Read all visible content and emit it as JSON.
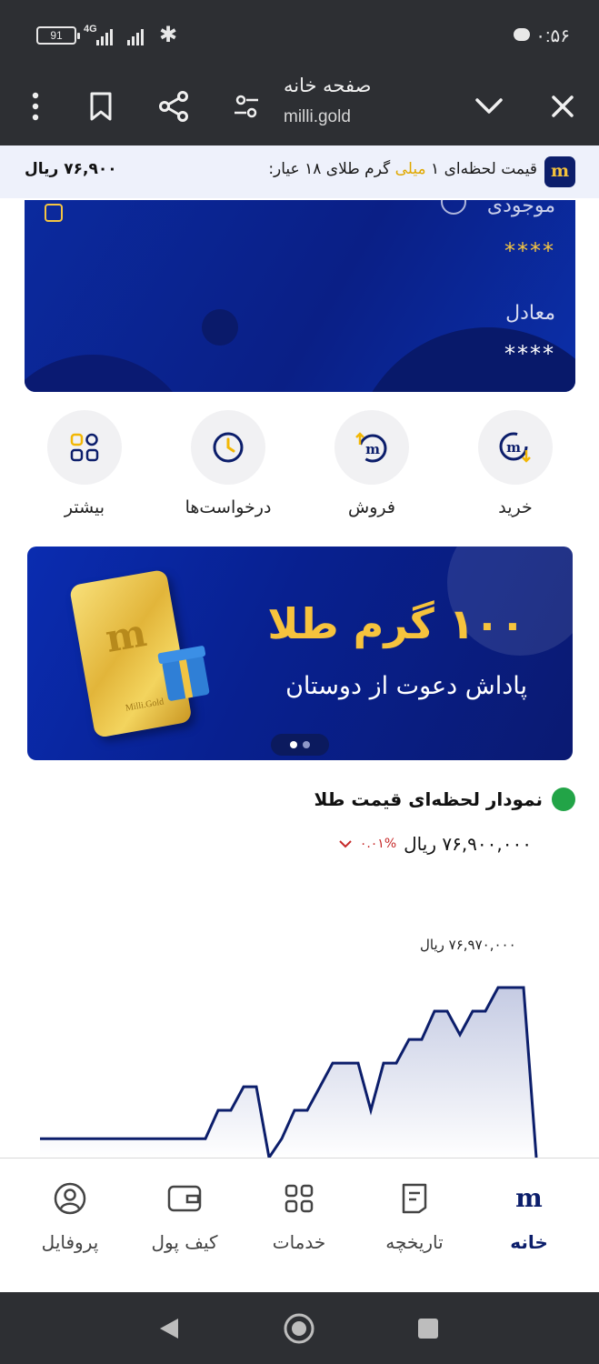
{
  "status_bar": {
    "battery": "91",
    "network": "4G",
    "time": "۰:۵۶"
  },
  "browser": {
    "title": "صفحه خانه",
    "url": "milli.gold"
  },
  "ticker": {
    "text_before": "قیمت لحظه‌ای ۱ ",
    "highlight": "میلی",
    "text_after": " گرم طلای ۱۸ عیار:",
    "price": "۷۶,۹۰۰ ریال",
    "logo_letter": "m"
  },
  "wallet": {
    "balance_label": "موجودی",
    "balance_value": "****",
    "equivalent_label": "معادل",
    "equivalent_value": "****"
  },
  "actions": [
    {
      "label": "خرید",
      "icon": "buy-icon"
    },
    {
      "label": "فروش",
      "icon": "sell-icon"
    },
    {
      "label": "درخواست‌ها",
      "icon": "clock-icon"
    },
    {
      "label": "بیشتر",
      "icon": "grid-icon"
    }
  ],
  "banner": {
    "headline": "۱۰۰ گرم طلا",
    "subline": "پاداش دعوت از دوستان",
    "gold_bar_letter": "m",
    "gold_bar_mark": "Milli.Gold",
    "slide_count": 2,
    "active_slide": 1
  },
  "chart": {
    "title": "نمودار لحظه‌ای قیمت طلا",
    "current_price": "۷۶,۹۰۰,۰۰۰ ریال",
    "change": "۰.۰۱%",
    "peak_label": "۷۶,۹۷۰,۰۰۰ ریال"
  },
  "chart_data": {
    "type": "area",
    "title": "نمودار لحظه‌ای قیمت طلا",
    "xlabel": "",
    "ylabel": "",
    "x": [
      0,
      1,
      2,
      3,
      4,
      5,
      6,
      7,
      8,
      9,
      10,
      11,
      12,
      13,
      14,
      15,
      16,
      17,
      18,
      19,
      20,
      21,
      22,
      23,
      24,
      25,
      26,
      27,
      28,
      29,
      30,
      31,
      32,
      33,
      34,
      35,
      36,
      37,
      38,
      39
    ],
    "values": [
      76900000,
      76900000,
      76900000,
      76900000,
      76900000,
      76900000,
      76900000,
      76900000,
      76900000,
      76900000,
      76900000,
      76900000,
      76900000,
      76900000,
      76912000,
      76912000,
      76922000,
      76922000,
      76892000,
      76900000,
      76912000,
      76912000,
      76922000,
      76932000,
      76932000,
      76932000,
      76912000,
      76932000,
      76932000,
      76942000,
      76942000,
      76954000,
      76954000,
      76944000,
      76954000,
      76954000,
      76964000,
      76964000,
      76964000,
      76892000
    ],
    "peak": 76970000,
    "ylim": [
      76892000,
      76974000
    ],
    "grid": false,
    "colors": {
      "line": "#0c1e6b",
      "fill_top": "#c5cbe3",
      "fill_bottom": "#ffffff"
    }
  },
  "bottom_nav": [
    {
      "label": "پروفایل",
      "icon": "profile-icon"
    },
    {
      "label": "کیف پول",
      "icon": "wallet-icon"
    },
    {
      "label": "خدمات",
      "icon": "services-icon"
    },
    {
      "label": "تاریخچه",
      "icon": "history-icon"
    },
    {
      "label": "خانه",
      "icon": "home-logo-icon",
      "active": true
    }
  ],
  "colors": {
    "brand_navy": "#0c1e6b",
    "brand_gold": "#f5c542",
    "card_blue": "#0a1f86",
    "positive": "#22a447",
    "negative": "#c62828"
  }
}
